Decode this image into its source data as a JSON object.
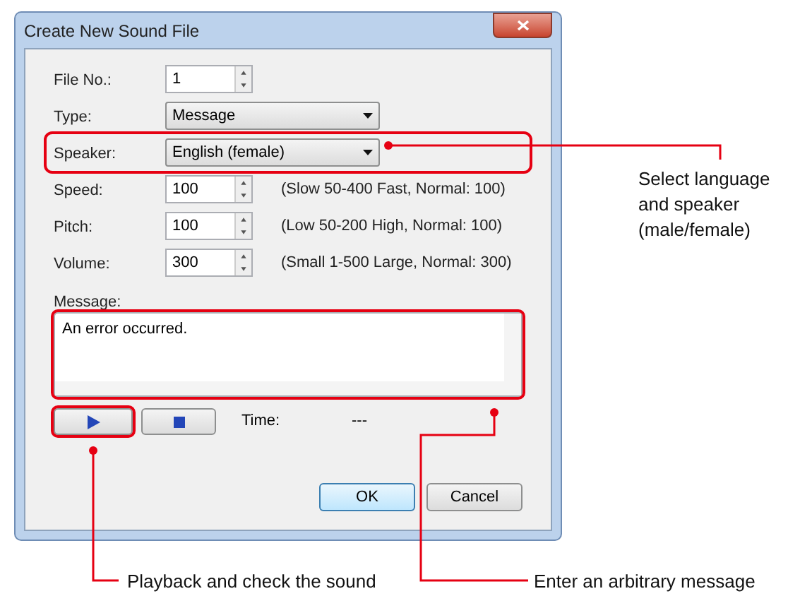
{
  "window": {
    "title": "Create New Sound File"
  },
  "fields": [
    {
      "kind": "spin",
      "label": "File No.:",
      "value": "1"
    },
    {
      "kind": "dropdown",
      "label": "Type:",
      "value": "Message",
      "highlighted": false
    },
    {
      "kind": "dropdown",
      "label": "Speaker:",
      "value": "English (female)",
      "highlighted": true
    },
    {
      "kind": "spin",
      "label": "Speed:",
      "value": "100",
      "hint": "(Slow 50-400 Fast, Normal: 100)"
    },
    {
      "kind": "spin",
      "label": "Pitch:",
      "value": "100",
      "hint": "(Low 50-200 High, Normal: 100)"
    },
    {
      "kind": "spin",
      "label": "Volume:",
      "value": "300",
      "hint": "(Small 1-500 Large, Normal: 300)"
    }
  ],
  "message": {
    "label": "Message:",
    "value": "An error occurred.",
    "highlighted": true
  },
  "playback": {
    "play_highlighted": true,
    "time_label": "Time:",
    "time_value": "---"
  },
  "buttons": [
    {
      "label": "OK",
      "default": true
    },
    {
      "label": "Cancel",
      "default": false
    }
  ],
  "callouts": [
    {
      "kind": "speaker",
      "text": "Select language and speaker (male/female)"
    },
    {
      "kind": "play",
      "text": "Playback and check the sound"
    },
    {
      "kind": "message",
      "text": "Enter an arbitrary message"
    }
  ]
}
